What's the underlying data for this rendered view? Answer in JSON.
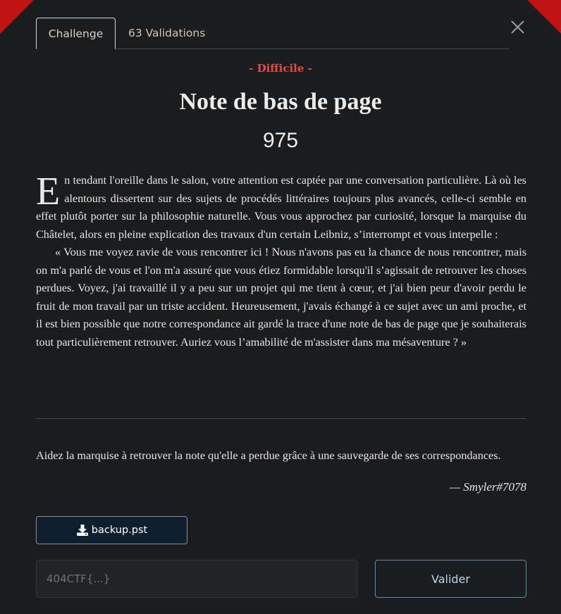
{
  "tabs": [
    {
      "label": "Challenge",
      "active": true
    },
    {
      "label": "63 Validations",
      "active": false
    }
  ],
  "close_icon": "close-icon",
  "challenge": {
    "difficulty": "- Difficile -",
    "title": "Note de bas de page",
    "points": "975",
    "description": {
      "dropcap": "E",
      "paragraph1": "n tendant l'oreille dans le salon, votre attention est captée par une conversation particulière. Là où les alentours dissertent sur des sujets de procédés littéraires toujours plus avancés, celle-ci semble en effet plutôt porter sur la philosophie naturelle. Vous vous approchez par curiosité, lorsque la marquise du Châtelet, alors en pleine explication des travaux d'un certain Leibniz, s’interrompt et vous interpelle :",
      "paragraph2": "« Vous me voyez ravie de vous rencontrer ici ! Nous n'avons pas eu la chance de nous rencontrer, mais on m'a parlé de vous et l'on m'a assuré que vous étiez formidable lorsqu'il s’agissait de retrouver les choses perdues. Voyez, j'ai travaillé il y a peu sur un projet qui me tient à cœur, et j'ai bien peur d'avoir perdu le fruit de mon travail par un triste accident. Heureusement, j'avais échangé à ce sujet avec un ami proche, et il est bien possible que notre correspondance ait gardé la trace d'une note de bas de page que je souhaiterais tout particulièrement retrouver. Auriez vous l’amabilité de m'assister dans ma mésaventure ? »"
    },
    "task": "Aidez la marquise à retrouver la note qu'elle a perdue grâce à une sauvegarde de ses correspondances.",
    "author": "— Smyler#7078"
  },
  "download": {
    "icon": "download-icon",
    "label": "backup.pst"
  },
  "flag": {
    "placeholder": "404CTF{...}",
    "value": "",
    "submit_label": "Valider"
  },
  "colors": {
    "background": "#1b1c1e",
    "corner_accent": "#c01414",
    "difficulty": "#e84a4a",
    "submit_border": "#5b8fb0",
    "download_bg": "#0f1e2e"
  }
}
